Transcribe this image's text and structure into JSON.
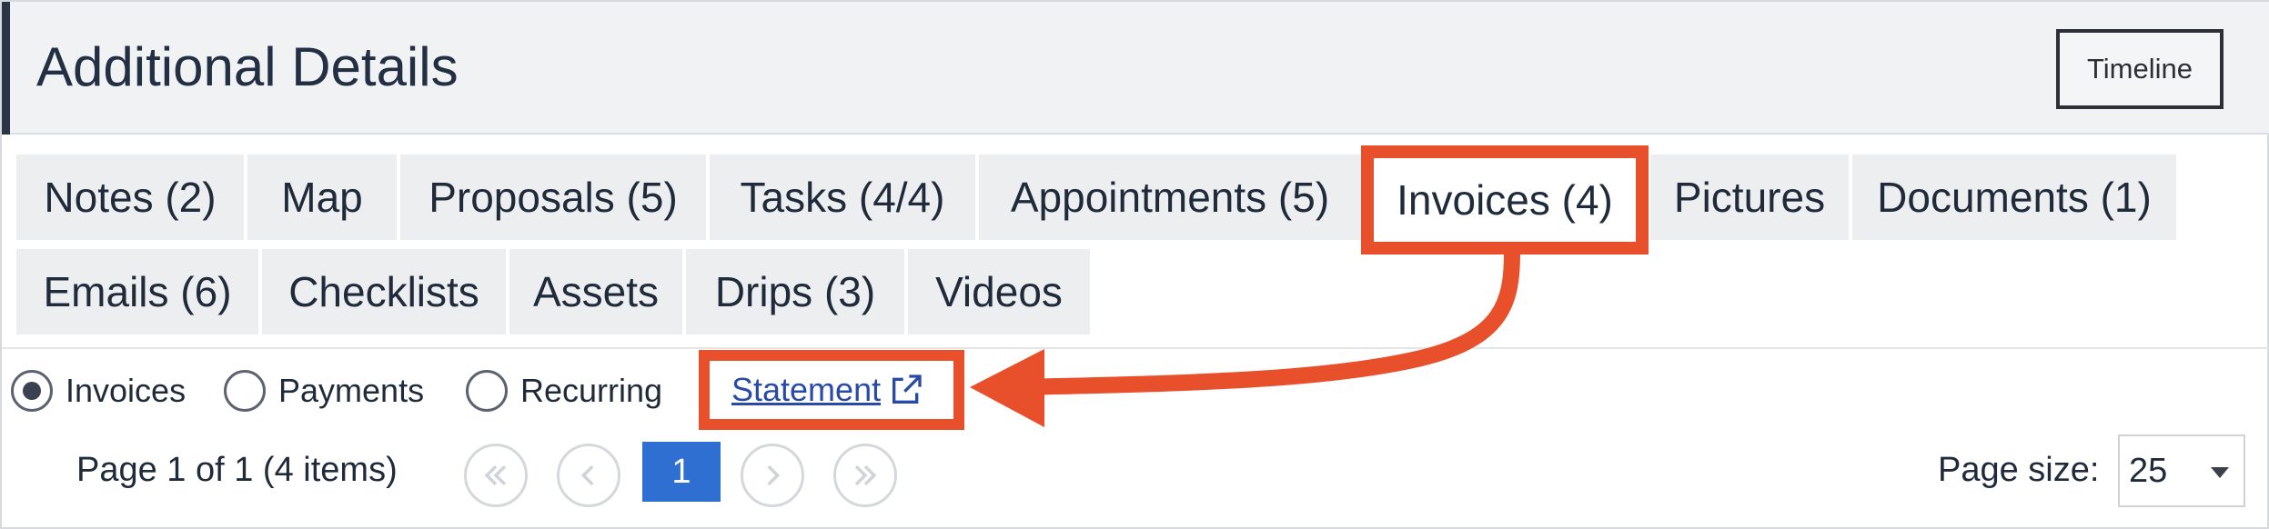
{
  "header": {
    "title": "Additional Details",
    "timeline_label": "Timeline"
  },
  "tabs": [
    {
      "label": "Notes (2)",
      "active": false
    },
    {
      "label": "Map",
      "active": false
    },
    {
      "label": "Proposals (5)",
      "active": false
    },
    {
      "label": "Tasks (4/4)",
      "active": false
    },
    {
      "label": "Appointments (5)",
      "active": false
    },
    {
      "label": "Invoices (4)",
      "active": true
    },
    {
      "label": "Pictures",
      "active": false
    },
    {
      "label": "Documents (1)",
      "active": false
    },
    {
      "label": "Emails (6)",
      "active": false
    },
    {
      "label": "Checklists",
      "active": false
    },
    {
      "label": "Assets",
      "active": false
    },
    {
      "label": "Drips (3)",
      "active": false
    },
    {
      "label": "Videos",
      "active": false
    }
  ],
  "view_options": [
    {
      "label": "Invoices",
      "checked": true
    },
    {
      "label": "Payments",
      "checked": false
    },
    {
      "label": "Recurring",
      "checked": false
    }
  ],
  "statement_link": "Statement",
  "pager": {
    "info": "Page 1 of 1 (4 items)",
    "current_page": "1",
    "page_size_label": "Page size:",
    "page_size_value": "25"
  },
  "icons": {
    "external_link": "external-link-icon",
    "first": "first-page-icon",
    "prev": "prev-page-icon",
    "next": "next-page-icon",
    "last": "last-page-icon"
  },
  "colors": {
    "highlight": "#e8502b",
    "link": "#2a4aa8",
    "page_active": "#2f6fd1",
    "header_bg": "#f1f2f4"
  }
}
